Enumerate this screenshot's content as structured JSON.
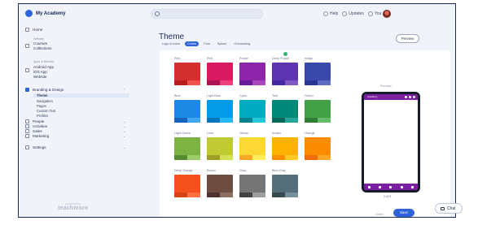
{
  "app": {
    "name": "My Academy"
  },
  "topbar": {
    "search_placeholder": "",
    "help": "Help",
    "updates": "Updates",
    "user": "You"
  },
  "sidebar": {
    "home": "Home",
    "section_website": "Website",
    "courses": "Courses",
    "collections": "Collections",
    "section_app": "Apps & Website",
    "android_app": "Android App",
    "ios_app": "iOS App",
    "website": "Website",
    "branding": "Branding & Design",
    "branding_sub": [
      "Theme",
      "Navigation",
      "Pages",
      "Custom Text",
      "Profiles"
    ],
    "people": "People",
    "activities": "Activities",
    "sales": "Sales",
    "marketing": "Marketing",
    "settings": "Settings",
    "powered_line1": "powered by",
    "powered_line2": "teachmore"
  },
  "main": {
    "title": "Theme",
    "preview_label": "Preview",
    "tabs": [
      "Logo & Icons",
      "Colors",
      "Font",
      "Splash",
      "Onboarding"
    ],
    "active_tab": "Colors",
    "phone_label": "Preview",
    "phone_caption": "1 of 3",
    "phone_app_title": "Academy",
    "footer_left": "Undo",
    "save_label": "Save"
  },
  "swatches": [
    {
      "name": "Red",
      "top": "#d32f2f",
      "b1": "#b71c1c",
      "b2": "#ef5350"
    },
    {
      "name": "Pink",
      "top": "#d81b60",
      "b1": "#ad1457",
      "b2": "#ec407a"
    },
    {
      "name": "Purple",
      "top": "#8e24aa",
      "b1": "#6a1b9a",
      "b2": "#ab47bc"
    },
    {
      "name": "Deep Purple",
      "top": "#5e35b1",
      "b1": "#4527a0",
      "b2": "#7e57c2",
      "selected": true
    },
    {
      "name": "Indigo",
      "top": "#3949ab",
      "b1": "#283593",
      "b2": "#5c6bc0"
    },
    {
      "name": "Blue",
      "top": "#1e88e5",
      "b1": "#1565c0",
      "b2": "#42a5f5"
    },
    {
      "name": "Light Blue",
      "top": "#039be5",
      "b1": "#0277bd",
      "b2": "#29b6f6"
    },
    {
      "name": "Cyan",
      "top": "#00acc1",
      "b1": "#00838f",
      "b2": "#26c6da"
    },
    {
      "name": "Teal",
      "top": "#00897b",
      "b1": "#00695c",
      "b2": "#26a69a"
    },
    {
      "name": "Green",
      "top": "#43a047",
      "b1": "#2e7d32",
      "b2": "#66bb6a"
    },
    {
      "name": "Light Green",
      "top": "#7cb342",
      "b1": "#558b2f",
      "b2": "#9ccc65"
    },
    {
      "name": "Lime",
      "top": "#c0ca33",
      "b1": "#9e9d24",
      "b2": "#d4e157"
    },
    {
      "name": "Yellow",
      "top": "#fdd835",
      "b1": "#f9a825",
      "b2": "#ffee58"
    },
    {
      "name": "Amber",
      "top": "#ffb300",
      "b1": "#ff8f00",
      "b2": "#ffca28"
    },
    {
      "name": "Orange",
      "top": "#fb8c00",
      "b1": "#ef6c00",
      "b2": "#ffa726"
    },
    {
      "name": "Deep Orange",
      "top": "#f4511e",
      "b1": "#d84315",
      "b2": "#ff7043"
    },
    {
      "name": "Brown",
      "top": "#6d4c41",
      "b1": "#4e342e",
      "b2": "#8d6e63"
    },
    {
      "name": "Gray",
      "top": "#757575",
      "b1": "#424242",
      "b2": "#9e9e9e"
    },
    {
      "name": "Blue Gray",
      "top": "#546e7a",
      "b1": "#37474f",
      "b2": "#78909c"
    }
  ],
  "chat": {
    "label": "Chat"
  },
  "colors": {
    "accent": "#2d62d8",
    "phone_theme": "#7b1fa2"
  }
}
